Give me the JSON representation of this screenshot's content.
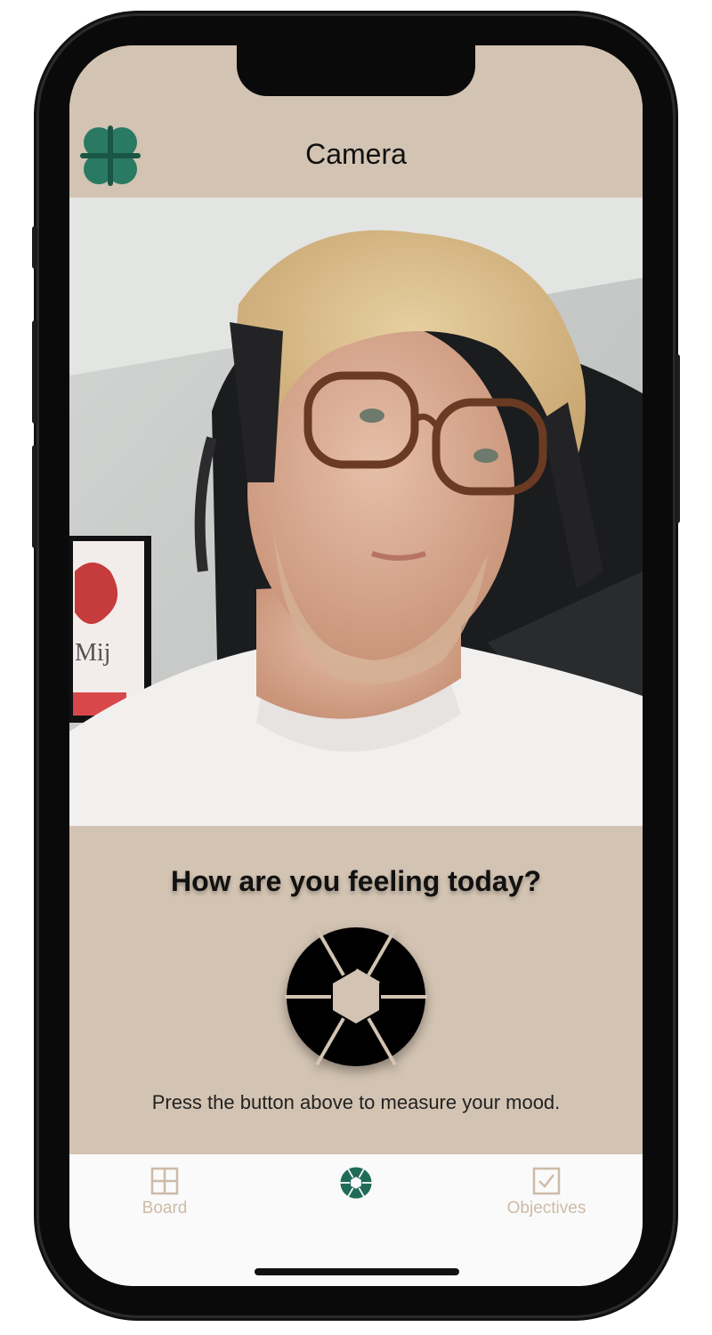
{
  "header": {
    "title": "Camera",
    "logo_icon": "clover-icon"
  },
  "photo": {
    "icon": "camera-preview-photo",
    "poster_text": "Mij"
  },
  "content": {
    "question": "How are you feeling today?",
    "capture_icon": "camera-shutter-icon",
    "hint": "Press the button above to measure your mood."
  },
  "tabs": [
    {
      "label": "Board",
      "icon": "grid-icon",
      "active": false
    },
    {
      "label": "",
      "icon": "camera-shutter-icon",
      "active": true
    },
    {
      "label": "Objectives",
      "icon": "checkbox-icon",
      "active": false
    }
  ],
  "colors": {
    "header_bg": "#d3c3b2",
    "accent": "#1f6b57",
    "inactive_tab": "#cdbba8",
    "tabbar_bg": "#fafafa"
  }
}
